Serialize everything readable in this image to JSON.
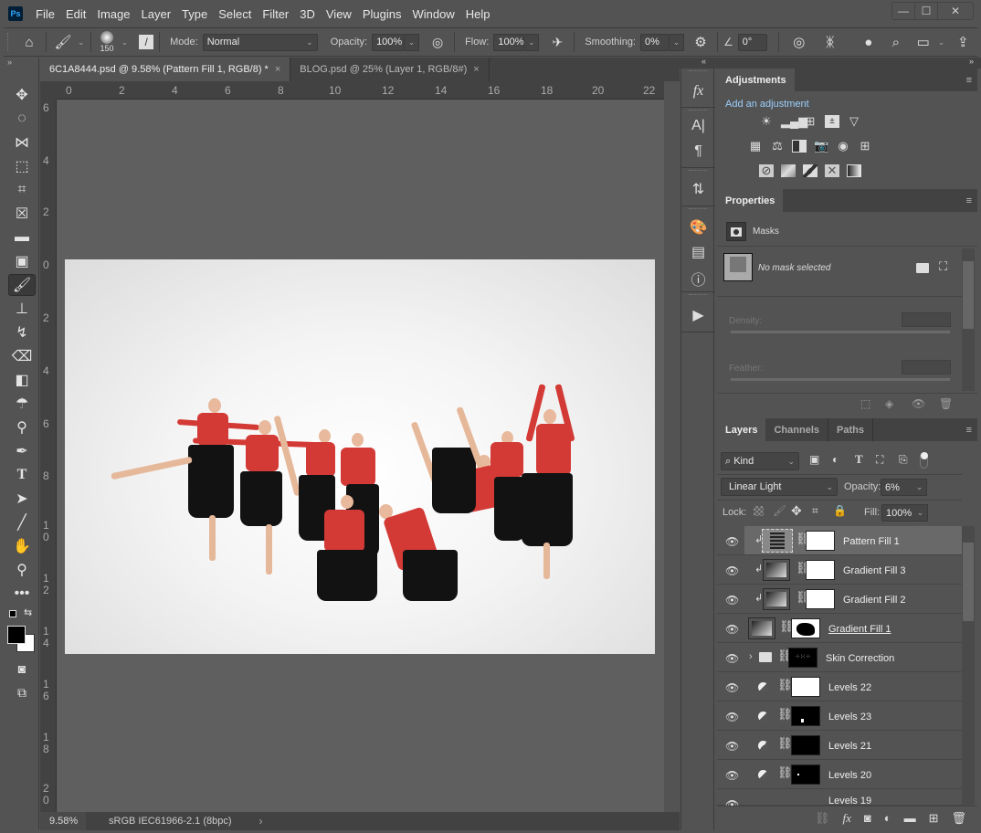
{
  "app": {
    "logo": "Ps",
    "menus": [
      "File",
      "Edit",
      "Image",
      "Layer",
      "Type",
      "Select",
      "Filter",
      "3D",
      "View",
      "Plugins",
      "Window",
      "Help"
    ]
  },
  "window_controls": {
    "minimize": "—",
    "maximize": "☐",
    "close": "✕"
  },
  "options_bar": {
    "brush_size": "150",
    "mode_label": "Mode:",
    "mode_value": "Normal",
    "opacity_label": "Opacity:",
    "opacity_value": "100%",
    "flow_label": "Flow:",
    "flow_value": "100%",
    "smoothing_label": "Smoothing:",
    "smoothing_value": "0%",
    "angle_value": "0°"
  },
  "tabs": [
    {
      "title": "6C1A8444.psd @ 9.58% (Pattern Fill 1, RGB/8) *",
      "close": "×"
    },
    {
      "title": "BLOG.psd @ 25% (Layer 1, RGB/8#)",
      "close": "×"
    }
  ],
  "ruler": {
    "h": [
      "0",
      "2",
      "4",
      "6",
      "8",
      "10",
      "12",
      "14",
      "16",
      "18",
      "20",
      "22"
    ],
    "v": [
      "6",
      "4",
      "2",
      "0",
      "2",
      "4",
      "6",
      "8",
      "10",
      "12",
      "14",
      "16",
      "18",
      "20"
    ]
  },
  "status": {
    "zoom": "9.58%",
    "profile": "sRGB IEC61966-2.1 (8bpc)",
    "arrow": "›"
  },
  "adjustments": {
    "tab": "Adjustments",
    "subtitle": "Add an adjustment",
    "row1": [
      "brightness-contrast",
      "levels",
      "curves",
      "exposure",
      "vibrance"
    ],
    "row2": [
      "hue-saturation",
      "color-balance",
      "black-white",
      "photo-filter",
      "channel-mixer",
      "color-lookup"
    ],
    "row3": [
      "invert",
      "posterize",
      "threshold",
      "selective-color",
      "gradient-map"
    ]
  },
  "properties": {
    "tab": "Properties",
    "section": "Masks",
    "no_mask": "No mask selected",
    "density_label": "Density:",
    "feather_label": "Feather:"
  },
  "layers_panel": {
    "tabs": [
      "Layers",
      "Channels",
      "Paths"
    ],
    "filter_kind": "Kind",
    "blend_mode": "Linear Light",
    "opacity_label": "Opacity:",
    "opacity_value": "6%",
    "lock_label": "Lock:",
    "fill_label": "Fill:",
    "fill_value": "100%",
    "layers": [
      {
        "name": "Pattern Fill 1",
        "type": "pattern",
        "clipped": true,
        "selected": true
      },
      {
        "name": "Gradient Fill 3",
        "type": "gradient",
        "clipped": true
      },
      {
        "name": "Gradient Fill 2",
        "type": "gradient",
        "clipped": true
      },
      {
        "name": "Gradient Fill 1",
        "type": "gradient",
        "clipped": false
      },
      {
        "name": "Skin Correction",
        "type": "group"
      },
      {
        "name": "Levels 22",
        "type": "levels"
      },
      {
        "name": "Levels 23",
        "type": "levels"
      },
      {
        "name": "Levels 21",
        "type": "levels"
      },
      {
        "name": "Levels 20",
        "type": "levels"
      },
      {
        "name": "Levels 19",
        "type": "levels"
      }
    ]
  }
}
